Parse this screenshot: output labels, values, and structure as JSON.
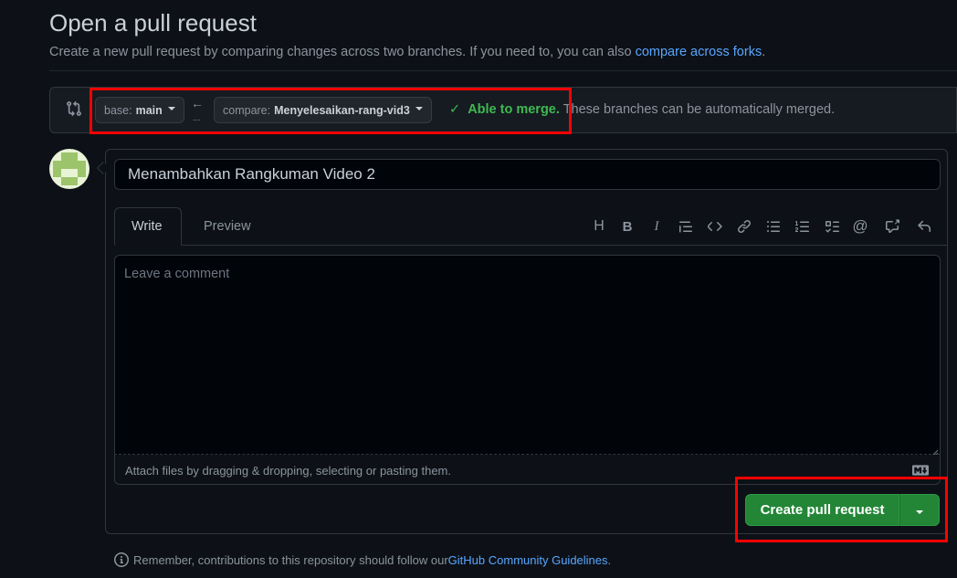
{
  "page": {
    "title": "Open a pull request",
    "subtitle_text": "Create a new pull request by comparing changes across two branches. If you need to, you can also ",
    "subtitle_link": "compare across forks",
    "subtitle_end": "."
  },
  "compare": {
    "base_label": "base:",
    "base_value": "main",
    "compare_label": "compare:",
    "compare_value": "Menyelesaikan-rang-vid3",
    "status_ok": "Able to merge.",
    "status_msg": "These branches can be automatically merged.",
    "dots": "...",
    "status_color": "#3fb950"
  },
  "form": {
    "title_value": "Menambahkan Rangkuman Video 2",
    "tabs": [
      {
        "label": "Write",
        "active": true
      },
      {
        "label": "Preview",
        "active": false
      }
    ],
    "toolbar": [
      "heading-icon",
      "bold-icon",
      "italic-icon",
      "quote-icon",
      "code-icon",
      "link-icon",
      "bulleted-list-icon",
      "numbered-list-icon",
      "task-list-icon",
      "mention-icon",
      "cross-reference-icon",
      "reply-icon"
    ],
    "comment_placeholder": "Leave a comment",
    "attach_text": "Attach files by dragging & dropping, selecting or pasting them.",
    "submit_label": "Create pull request",
    "accent_color": "#238636"
  },
  "footer": {
    "remember_text": "Remember, contributions to this repository should follow our ",
    "remember_link": "GitHub Community Guidelines",
    "remember_end": "."
  }
}
